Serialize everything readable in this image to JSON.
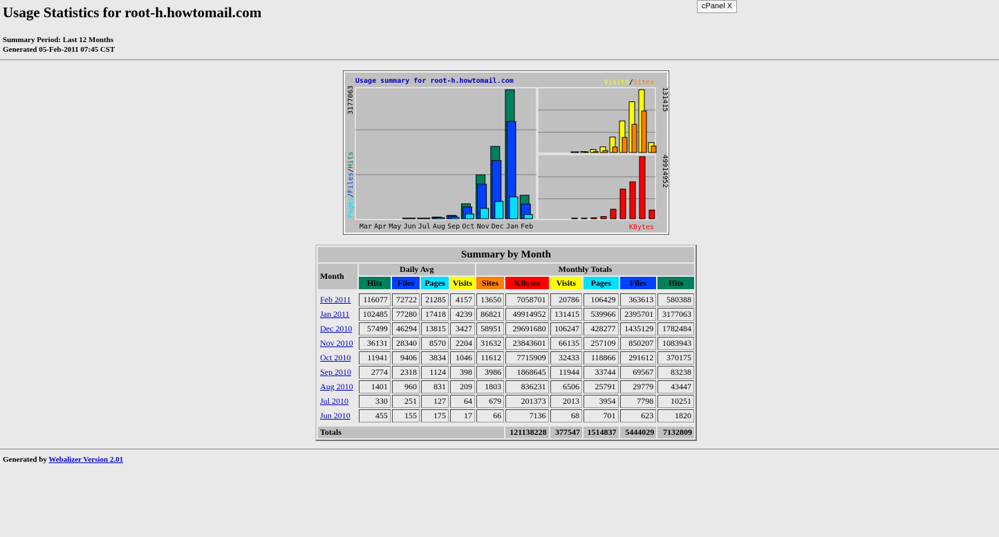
{
  "header": {
    "title": "Usage Statistics for root-h.howtomail.com",
    "summary_period": "Summary Period: Last 12 Months",
    "generated": "Generated 05-Feb-2011 07:45 CST",
    "cpanel_button": "cPanel X"
  },
  "colors": {
    "hits": "#00805c",
    "files": "#0040ff",
    "pages": "#00e0ff",
    "visits": "#ffff00",
    "sites": "#ff8000",
    "kbytes": "#ff0000"
  },
  "chart_data": {
    "type": "bar",
    "title": "Usage summary for root-h.howtomail.com",
    "categories": [
      "Mar",
      "Apr",
      "May",
      "Jun",
      "Jul",
      "Aug",
      "Sep",
      "Oct",
      "Nov",
      "Dec",
      "Jan",
      "Feb"
    ],
    "left_axis_label": [
      "Pages",
      "/",
      "Files",
      "/",
      "Hits"
    ],
    "left_max_label": "3177063",
    "right_top_legend": [
      "Visits",
      "/",
      "Sites"
    ],
    "right_top_max_label": "131415",
    "right_bottom_legend": "KBytes",
    "right_bottom_max_label": "49914952",
    "series": [
      {
        "name": "Hits",
        "values": [
          0,
          0,
          0,
          1820,
          10251,
          43447,
          83238,
          370175,
          1083943,
          1782484,
          3177063,
          580388
        ]
      },
      {
        "name": "Files",
        "values": [
          0,
          0,
          0,
          623,
          7798,
          29779,
          69567,
          291612,
          850207,
          1435129,
          2395701,
          363613
        ]
      },
      {
        "name": "Pages",
        "values": [
          0,
          0,
          0,
          701,
          3954,
          25791,
          33744,
          118866,
          257109,
          428277,
          539966,
          106429
        ]
      },
      {
        "name": "Visits",
        "values": [
          0,
          0,
          0,
          68,
          2013,
          6506,
          11944,
          32433,
          66135,
          106247,
          131415,
          20786
        ]
      },
      {
        "name": "Sites",
        "values": [
          0,
          0,
          0,
          66,
          679,
          1803,
          3986,
          11612,
          31632,
          58951,
          86821,
          13650
        ]
      },
      {
        "name": "KBytes",
        "values": [
          0,
          0,
          0,
          7136,
          201373,
          836231,
          1868645,
          7715909,
          23843601,
          29691680,
          49914952,
          7058701
        ]
      }
    ]
  },
  "table": {
    "title": "Summary by Month",
    "month_header": "Month",
    "daily_avg_header": "Daily Avg",
    "monthly_totals_header": "Monthly Totals",
    "columns": [
      "Hits",
      "Files",
      "Pages",
      "Visits",
      "Sites",
      "KBytes",
      "Visits",
      "Pages",
      "Files",
      "Hits"
    ],
    "rows": [
      {
        "month": "Feb 2011",
        "values": [
          "116077",
          "72722",
          "21285",
          "4157",
          "13650",
          "7058701",
          "20786",
          "106429",
          "363613",
          "580388"
        ]
      },
      {
        "month": "Jan 2011",
        "values": [
          "102485",
          "77280",
          "17418",
          "4239",
          "86821",
          "49914952",
          "131415",
          "539966",
          "2395701",
          "3177063"
        ]
      },
      {
        "month": "Dec 2010",
        "values": [
          "57499",
          "46294",
          "13815",
          "3427",
          "58951",
          "29691680",
          "106247",
          "428277",
          "1435129",
          "1782484"
        ]
      },
      {
        "month": "Nov 2010",
        "values": [
          "36131",
          "28340",
          "8570",
          "2204",
          "31632",
          "23843601",
          "66135",
          "257109",
          "850207",
          "1083943"
        ]
      },
      {
        "month": "Oct 2010",
        "values": [
          "11941",
          "9406",
          "3834",
          "1046",
          "11612",
          "7715909",
          "32433",
          "118866",
          "291612",
          "370175"
        ]
      },
      {
        "month": "Sep 2010",
        "values": [
          "2774",
          "2318",
          "1124",
          "398",
          "3986",
          "1868645",
          "11944",
          "33744",
          "69567",
          "83238"
        ]
      },
      {
        "month": "Aug 2010",
        "values": [
          "1401",
          "960",
          "831",
          "209",
          "1803",
          "836231",
          "6506",
          "25791",
          "29779",
          "43447"
        ]
      },
      {
        "month": "Jul 2010",
        "values": [
          "330",
          "251",
          "127",
          "64",
          "679",
          "201373",
          "2013",
          "3954",
          "7798",
          "10251"
        ]
      },
      {
        "month": "Jun 2010",
        "values": [
          "455",
          "155",
          "175",
          "17",
          "66",
          "7136",
          "68",
          "701",
          "623",
          "1820"
        ]
      }
    ],
    "totals_label": "Totals",
    "totals": [
      "121138228",
      "377547",
      "1514837",
      "5444029",
      "7132809"
    ]
  },
  "footer": {
    "prefix": "Generated by ",
    "link": "Webalizer Version 2.01"
  }
}
